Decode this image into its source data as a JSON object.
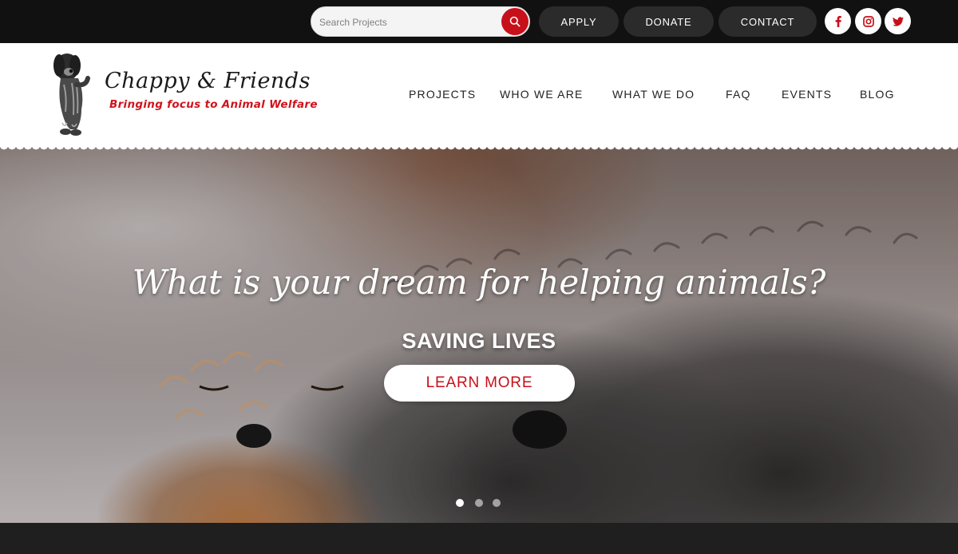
{
  "topbar": {
    "search": {
      "placeholder": "Search Projects",
      "value": ""
    },
    "buttons": [
      {
        "label": "APPLY"
      },
      {
        "label": "DONATE"
      },
      {
        "label": "CONTACT"
      }
    ],
    "social": [
      "facebook-icon",
      "instagram-icon",
      "twitter-icon"
    ]
  },
  "brand": {
    "name": "Chappy & Friends",
    "tagline": "Bringing focus to Animal Welfare"
  },
  "nav": {
    "items": [
      {
        "label": "PROJECTS"
      },
      {
        "label": "WHO WE ARE"
      },
      {
        "label": "WHAT WE DO"
      },
      {
        "label": "FAQ"
      },
      {
        "label": "EVENTS"
      },
      {
        "label": "BLOG"
      }
    ]
  },
  "hero": {
    "title": "What is your dream for helping animals?",
    "subtitle": "SAVING LIVES",
    "cta_label": "LEARN MORE",
    "slide_count": 3,
    "active_slide": 1
  },
  "colors": {
    "accent": "#c8101a",
    "topbar": "#111111",
    "pill": "#2b2b2b",
    "tagline": "#d0141d"
  }
}
